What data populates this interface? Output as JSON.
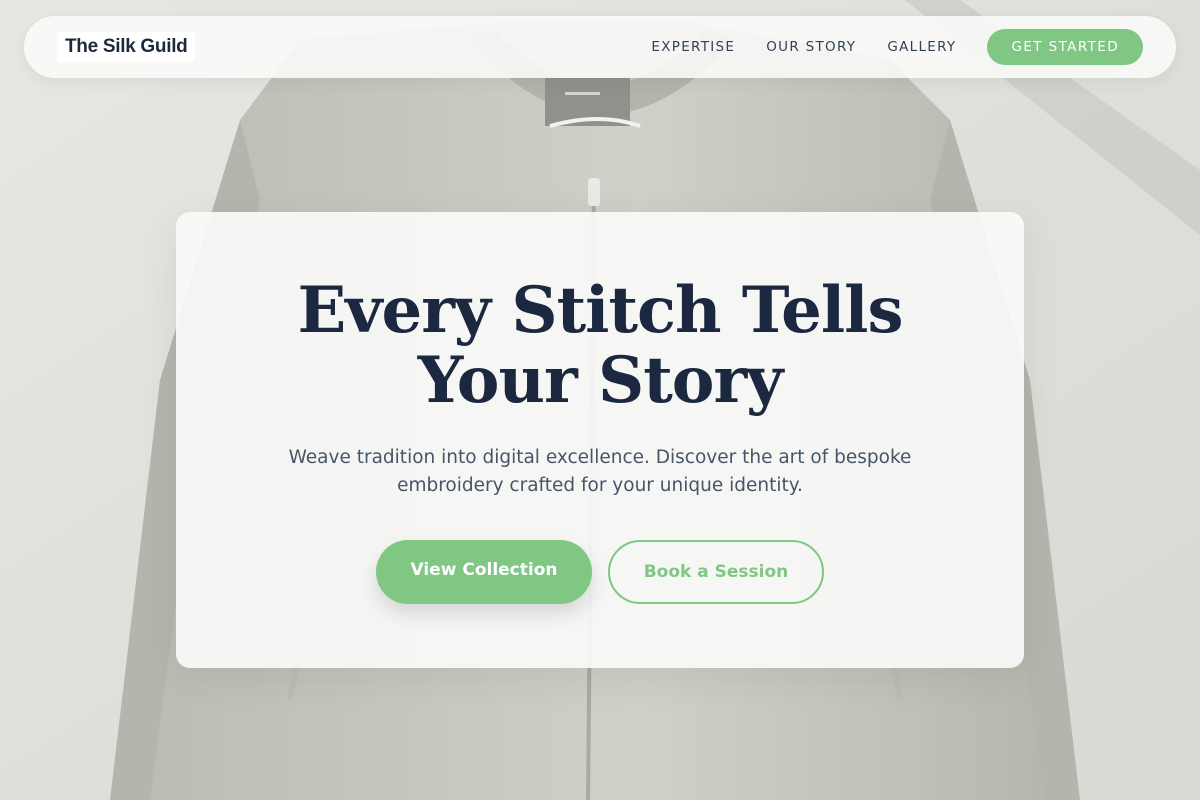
{
  "nav": {
    "brand": "The Silk Guild",
    "links": [
      "EXPERTISE",
      "OUR STORY",
      "GALLERY"
    ],
    "cta_label": "GET STARTED"
  },
  "hero": {
    "title_line1": "Every Stitch Tells",
    "title_line2": "Your Story",
    "subtitle_line1": "Weave tradition into digital excellence. Discover the art of bespoke",
    "subtitle_line2": "embroidery crafted for your unique identity.",
    "primary_button": "View Collection",
    "secondary_button": "Book a Session"
  },
  "colors": {
    "accent": "#7fc783",
    "heading": "#1b2840",
    "body_text": "#475569",
    "background": "#d9dcd6"
  }
}
